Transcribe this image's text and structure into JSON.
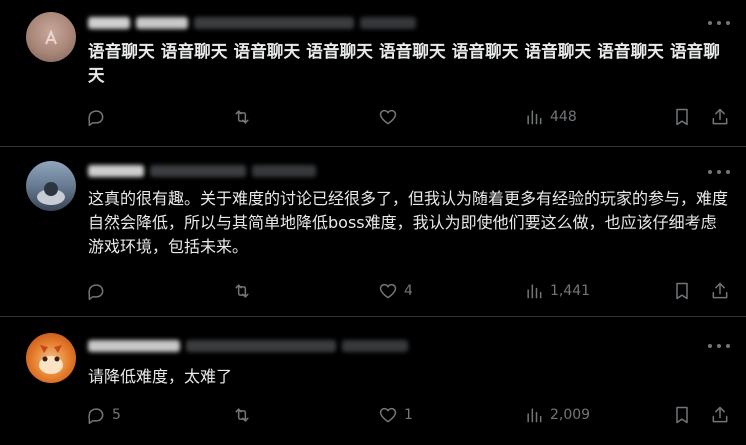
{
  "posts": [
    {
      "text": "语音聊天 语音聊天 语音聊天 语音聊天 语音聊天 语音聊天 语音聊天 语音聊天 语音聊天",
      "reply_count": "",
      "retweet_count": "",
      "like_count": "",
      "view_count": "448"
    },
    {
      "text": "这真的很有趣。关于难度的讨论已经很多了，但我认为随着更多有经验的玩家的参与，难度自然会降低，所以与其简单地降低boss难度，我认为即使他们要这么做，也应该仔细考虑游戏环境，包括未来。",
      "reply_count": "",
      "retweet_count": "",
      "like_count": "4",
      "view_count": "1,441"
    },
    {
      "text": "请降低难度，太难了",
      "reply_count": "5",
      "retweet_count": "",
      "like_count": "1",
      "view_count": "2,009"
    }
  ],
  "icons": {
    "reply": "reply-icon",
    "retweet": "retweet-icon",
    "like": "heart-icon",
    "views": "views-icon",
    "bookmark": "bookmark-icon",
    "share": "share-icon",
    "more": "more-icon"
  },
  "colors": {
    "background": "#000000",
    "text": "#e7e9ea",
    "muted": "#71767b",
    "divider": "#2f3336"
  }
}
